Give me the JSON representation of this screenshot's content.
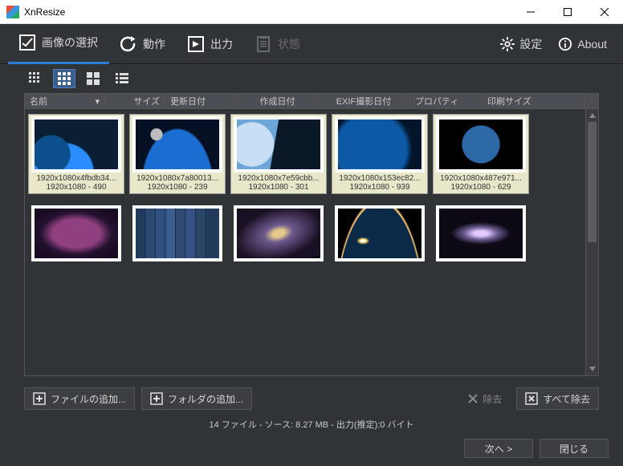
{
  "window": {
    "title": "XnResize"
  },
  "tabs": {
    "select": "画像の選択",
    "action": "動作",
    "output": "出力",
    "status": "状態",
    "settings": "設定",
    "about": "About"
  },
  "columns": {
    "name": "名前",
    "size": "サイズ",
    "modified": "更新日付",
    "created": "作成日付",
    "exifdate": "EXIF撮影日付",
    "props": "プロパティ",
    "printsize": "印刷サイズ"
  },
  "thumbs": [
    {
      "name": "1920x1080x4fbdb34...",
      "info": "1920x1080 - 490",
      "art": "art-planet",
      "sel": true
    },
    {
      "name": "1920x1080x7a80013...",
      "info": "1920x1080 - 239",
      "art": "art-moon",
      "sel": true
    },
    {
      "name": "1920x1080x7e59cbb...",
      "info": "1920x1080 - 301",
      "art": "art-horizon",
      "sel": true
    },
    {
      "name": "1920x1080x153ec82...",
      "info": "1920x1080 - 939",
      "art": "art-earthclose",
      "sel": true
    },
    {
      "name": "1920x1080x487e971...",
      "info": "1920x1080 - 629",
      "art": "art-earthfull",
      "sel": true
    },
    {
      "name": "",
      "info": "",
      "art": "art-nebula",
      "sel": false
    },
    {
      "name": "",
      "info": "",
      "art": "art-panels",
      "sel": false
    },
    {
      "name": "",
      "info": "",
      "art": "art-galaxy1",
      "sel": false
    },
    {
      "name": "",
      "info": "",
      "art": "art-sun",
      "sel": false
    },
    {
      "name": "",
      "info": "",
      "art": "art-galaxy2",
      "sel": false
    }
  ],
  "buttons": {
    "addfile": "ファイルの追加...",
    "addfolder": "フォルダの追加...",
    "remove": "除去",
    "removeall": "すべて除去",
    "next": "次へ >",
    "close": "閉じる"
  },
  "status": "14 ファイル - ソース: 8.27 MB - 出力(推定):0 バイト"
}
